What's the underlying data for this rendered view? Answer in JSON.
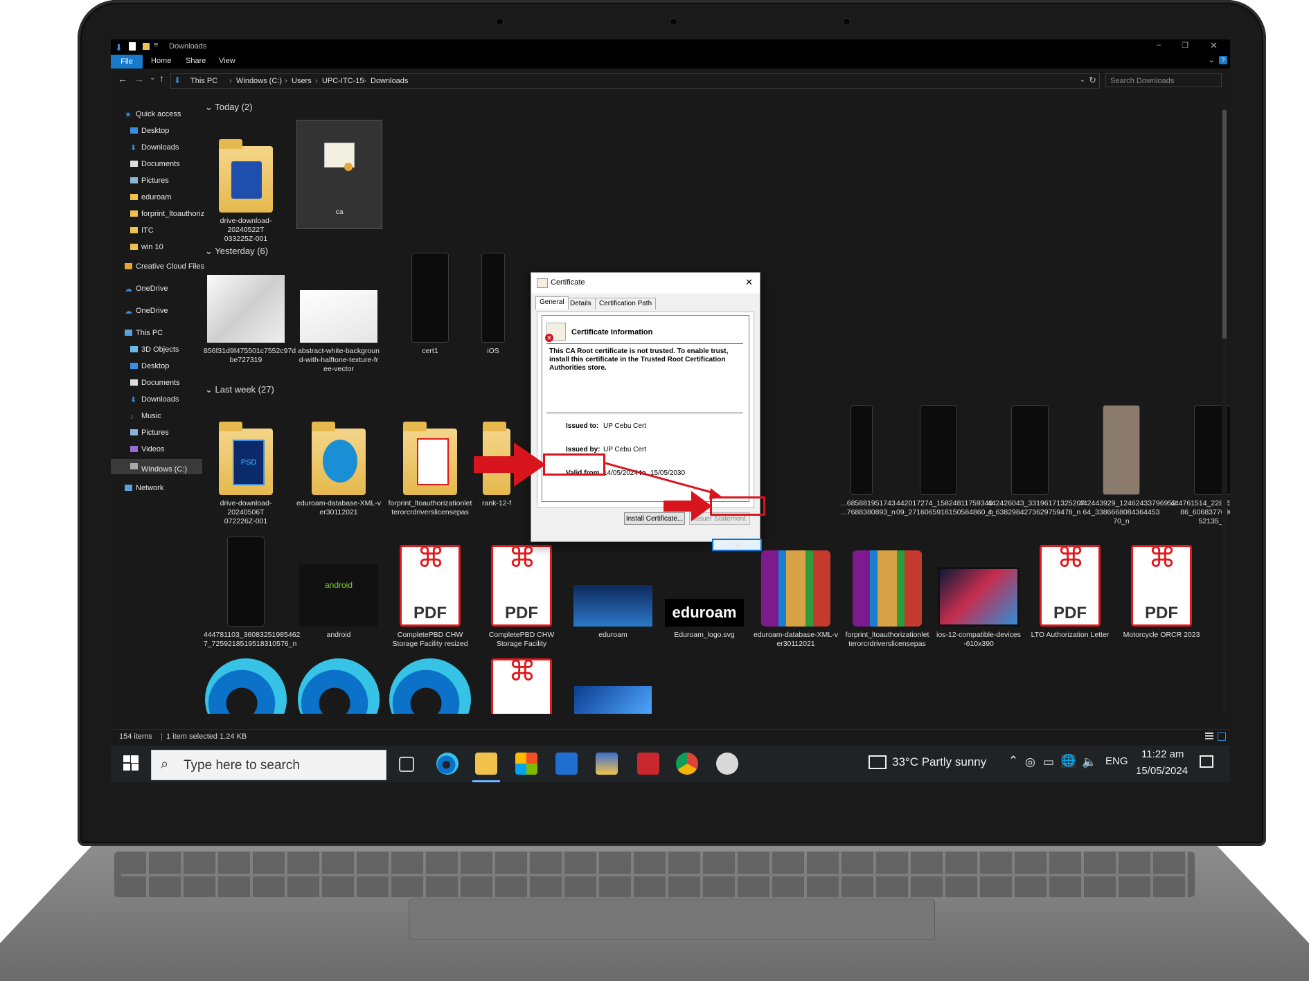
{
  "explorer": {
    "title": "Downloads",
    "ribbon_tabs": [
      "File",
      "Home",
      "Share",
      "View"
    ],
    "breadcrumb": [
      "This PC",
      "Windows (C:)",
      "Users",
      "UPC-ITC-15",
      "Downloads"
    ],
    "search_placeholder": "Search Downloads",
    "nav": {
      "quick_access": "Quick access",
      "quick_items": [
        "Desktop",
        "Downloads",
        "Documents",
        "Pictures",
        "eduroam",
        "forprint_ltoauthoriz",
        "ITC",
        "win 10"
      ],
      "creative_cloud": "Creative Cloud Files",
      "onedrive1": "OneDrive",
      "onedrive2": "OneDrive",
      "this_pc": "This PC",
      "pc_items": [
        "3D Objects",
        "Desktop",
        "Documents",
        "Downloads",
        "Music",
        "Pictures",
        "Videos",
        "Windows (C:)"
      ],
      "network": "Network"
    },
    "groups": {
      "today": "Today (2)",
      "yesterday": "Yesterday (6)",
      "last_week": "Last week (27)"
    },
    "today_files": [
      {
        "line1": "drive-download-20240522T",
        "line2": "033225Z-001"
      },
      {
        "line1": "ca",
        "line2": ""
      }
    ],
    "yesterday_files": [
      {
        "line1": "856f31d9f475501c7552c97d",
        "line2": "be727319",
        "line3": ""
      },
      {
        "line1": "abstract-white-backgroun",
        "line2": "d-with-halftone-texture-fr",
        "line3": "ee-vector"
      },
      {
        "line1": "cert1",
        "line2": "",
        "line3": ""
      },
      {
        "line1": "iOS",
        "line2": "",
        "line3": ""
      }
    ],
    "week_row1": [
      {
        "line1": "drive-download-20240506T",
        "line2": "072226Z-001"
      },
      {
        "line1": "eduroam-database-XML-v",
        "line2": "er30112021"
      },
      {
        "line1": "forprint_ltoauthorizationlet",
        "line2": "terorcrdriverslicensepas"
      },
      {
        "line1": "rank-12-f",
        "line2": ""
      },
      {
        "line1": "...685881951743",
        "line2": "...7688380893_n"
      },
      {
        "line1": "442017274_15824811759349",
        "line2": "09_2716065916150584860_n"
      },
      {
        "line1": "442426043_33196171325207",
        "line2": "4_6382984273629759478_n"
      },
      {
        "line1": "442443929_12462433796952",
        "line2": "64_3386668084364453 70_n"
      },
      {
        "line1": "444761514_22895955547046",
        "line2": "86_6068377696062 52135_n"
      }
    ],
    "week_row2": [
      {
        "line1": "444781103_36083251985462",
        "line2": "7_7259218519518310576_n"
      },
      {
        "line1": "android",
        "line2": ""
      },
      {
        "line1": "CompletePBD CHW",
        "line2": "Storage Facility resized"
      },
      {
        "line1": "CompletePBD CHW",
        "line2": "Storage Facility"
      },
      {
        "line1": "eduroam",
        "line2": ""
      },
      {
        "line1": "Eduroam_logo.svg",
        "line2": ""
      },
      {
        "line1": "eduroam-database-XML-v",
        "line2": "er30112021"
      },
      {
        "line1": "forprint_ltoauthorizationlet",
        "line2": "terorcrdriverslicensepas"
      },
      {
        "line1": "ios-12-compatible-devices",
        "line2": "-610x390"
      },
      {
        "line1": "LTO Authorization Letter",
        "line2": ""
      },
      {
        "line1": "Motorcycle ORCR 2023",
        "line2": ""
      }
    ],
    "thumb_text": {
      "psd": "PSD",
      "pdf": "PDF",
      "android": "android",
      "eduroam_logo": "eduroam"
    },
    "status": {
      "items": "154 items",
      "selected": "1 item selected  1.24 KB"
    }
  },
  "dialog": {
    "title": "Certificate",
    "tabs": [
      "General",
      "Details",
      "Certification Path"
    ],
    "heading": "Certificate Information",
    "message": "This CA Root certificate is not trusted. To enable trust, install this certificate in the Trusted Root Certification Authorities store.",
    "issued_to_label": "Issued to:",
    "issued_to": "UP Cebu Cert",
    "issued_by_label": "Issued by:",
    "issued_by": "UP Cebu Cert",
    "valid_from_label": "Valid from",
    "valid_from": "14/05/2024",
    "valid_to_label": "to",
    "valid_to": "15/05/2030",
    "install_button": "Install Certificate...",
    "issuer_button": "Issuer Statement",
    "ok_button": "OK"
  },
  "taskbar": {
    "search_placeholder": "Type here to search",
    "weather": "33°C  Partly sunny",
    "language": "ENG",
    "time": "11:22 am",
    "date": "15/05/2024"
  },
  "colors": {
    "accent": "#1979ca",
    "annotation_red": "#d8141c",
    "pdf_red": "#e0191d"
  }
}
